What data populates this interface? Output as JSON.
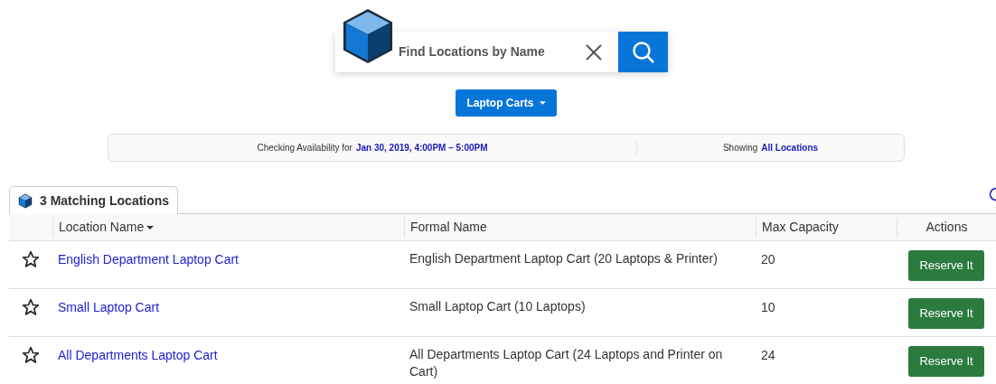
{
  "search": {
    "placeholder": "Find Locations by Name"
  },
  "category_button": {
    "label": "Laptop Carts"
  },
  "availability_bar": {
    "label": "Checking Availability for",
    "value": "Jan 30, 2019, 4:00PM – 5:00PM",
    "showing_label": "Showing",
    "showing_value": "All Locations"
  },
  "tab": {
    "label": "3 Matching Locations"
  },
  "table": {
    "columns": [
      {
        "label": "Location Name",
        "sorted": true
      },
      {
        "label": "Formal Name",
        "sorted": false
      },
      {
        "label": "Max Capacity",
        "sorted": false
      },
      {
        "label": "Actions",
        "sorted": false
      }
    ],
    "rows": [
      {
        "favorite": false,
        "name": "English Department Laptop Cart",
        "formal_name": "English Department Laptop Cart (20 Laptops & Printer)",
        "capacity": "20",
        "action": "Reserve It"
      },
      {
        "favorite": false,
        "name": "Small Laptop Cart",
        "formal_name": "Small Laptop Cart (10 Laptops)",
        "capacity": "10",
        "action": "Reserve It"
      },
      {
        "favorite": false,
        "name": "All Departments Laptop Cart",
        "formal_name": "All Departments Laptop Cart (24 Laptops and Printer on Cart)",
        "capacity": "24",
        "action": "Reserve It"
      }
    ]
  }
}
